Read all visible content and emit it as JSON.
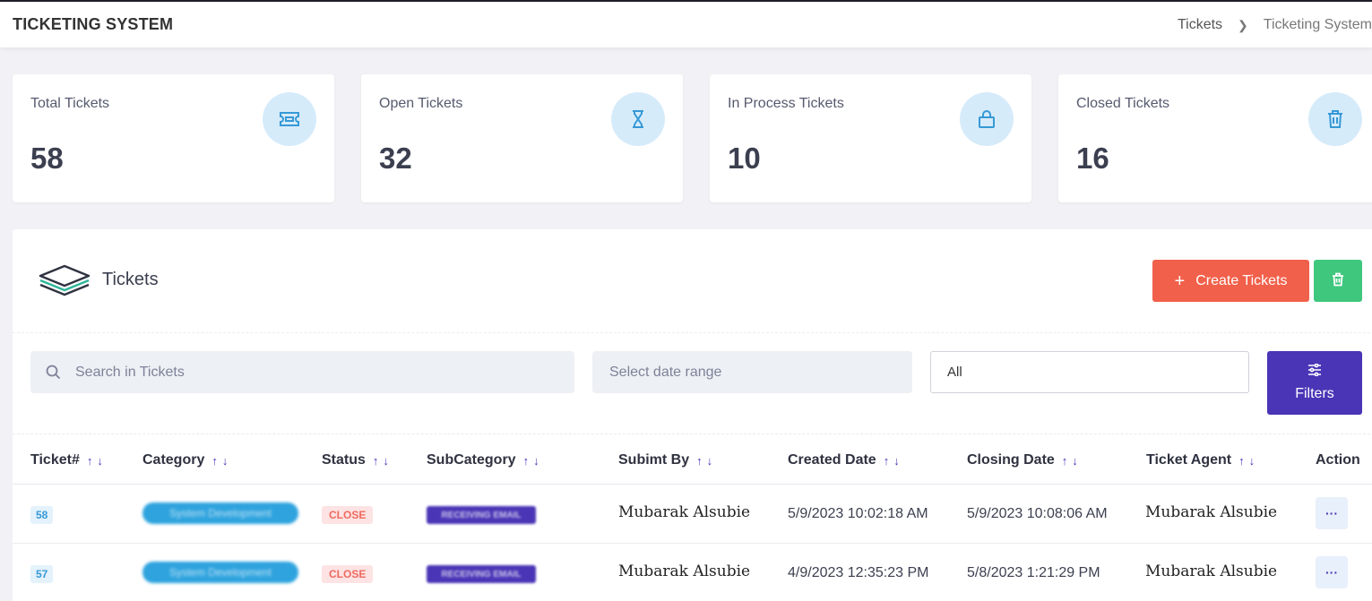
{
  "header": {
    "title": "TICKETING SYSTEM",
    "breadcrumb": [
      "Tickets",
      "Ticketing System"
    ]
  },
  "stats": [
    {
      "label": "Total Tickets",
      "value": "58",
      "icon": "ticket-icon"
    },
    {
      "label": "Open Tickets",
      "value": "32",
      "icon": "hourglass-icon"
    },
    {
      "label": "In Process Tickets",
      "value": "10",
      "icon": "lock-icon"
    },
    {
      "label": "Closed Tickets",
      "value": "16",
      "icon": "trash-icon"
    }
  ],
  "panel": {
    "title": "Tickets",
    "create_label": "Create Tickets",
    "create_icon": "+",
    "search_placeholder": "Search in Tickets",
    "date_placeholder": "Select date range",
    "status_select": "All",
    "filters_label": "Filters"
  },
  "table": {
    "columns": [
      "Ticket#",
      "Category",
      "Status",
      "SubCategory",
      "Subimt By",
      "Created Date",
      "Closing Date",
      "Ticket Agent",
      "Action"
    ],
    "rows": [
      {
        "id": "58",
        "category": "System Development",
        "status": "CLOSE",
        "subcategory": "RECEIVING EMAIL",
        "submit_by": "Mubarak Alsubie",
        "created": "5/9/2023 10:02:18 AM",
        "closing": "5/9/2023 10:08:06 AM",
        "agent": "Mubarak Alsubie",
        "action": "···"
      },
      {
        "id": "57",
        "category": "System Development",
        "status": "CLOSE",
        "subcategory": "RECEIVING EMAIL",
        "submit_by": "Mubarak Alsubie",
        "created": "4/9/2023 12:35:23 PM",
        "closing": "5/8/2023 1:21:29 PM",
        "agent": "Mubarak Alsubie",
        "action": "···"
      }
    ]
  },
  "colors": {
    "accent": "#4a35b6",
    "create": "#f1604a",
    "delete": "#3fc77d",
    "icon_bg": "#d6ebfa",
    "icon": "#3699d6"
  }
}
